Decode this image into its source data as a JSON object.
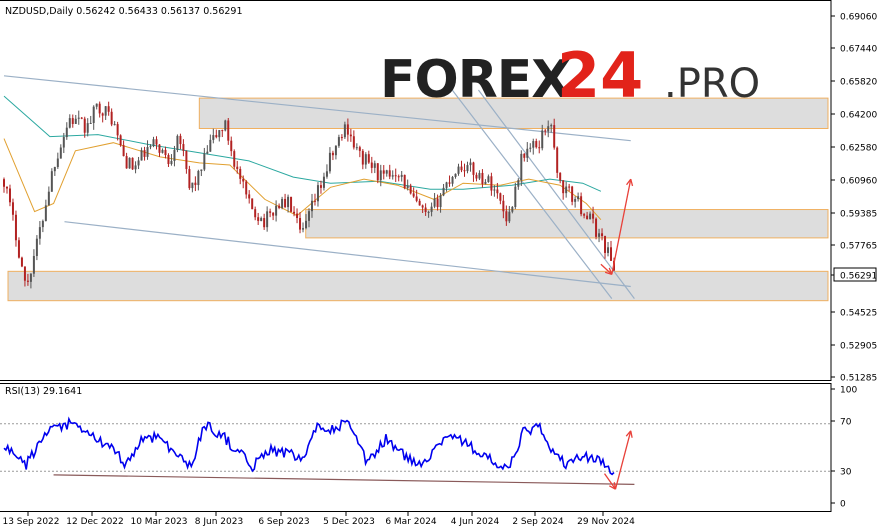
{
  "header": {
    "instrument_text": "NZDUSD,Daily  0.56242 0.56433 0.56137 0.56291"
  },
  "watermark": {
    "brand": "FOREX",
    "number": "24",
    "suffix": ".PRO",
    "colors": {
      "brand": "#222222",
      "number": "#e2231a",
      "suffix": "#333333"
    }
  },
  "chart_data": [
    {
      "type": "candlestick",
      "title": "NZDUSD,Daily",
      "ohlc_text": "0.56242 0.56433 0.56137 0.56291",
      "last_price": "0.56291",
      "ylim": [
        0.5128,
        0.6915
      ],
      "y_ticks": [
        "0.69060",
        "0.67440",
        "0.65820",
        "0.64200",
        "0.62580",
        "0.60960",
        "0.59385",
        "0.57765",
        "0.56291",
        "0.54525",
        "0.52905",
        "0.51285"
      ],
      "x_ticks": [
        "13 Sep 2022",
        "12 Dec 2022",
        "10 Mar 2023",
        "8 Jun 2023",
        "6 Sep 2023",
        "5 Dec 2023",
        "6 Mar 2024",
        "4 Jun 2024",
        "2 Sep 2024",
        "29 Nov 2024"
      ],
      "price_path": [
        [
          "2022-09-13",
          0.608
        ],
        [
          "2022-10-01",
          0.578
        ],
        [
          "2022-10-13",
          0.554
        ],
        [
          "2022-11-01",
          0.582
        ],
        [
          "2022-11-20",
          0.615
        ],
        [
          "2022-12-12",
          0.638
        ],
        [
          "2023-01-05",
          0.633
        ],
        [
          "2023-01-20",
          0.645
        ],
        [
          "2023-02-08",
          0.638
        ],
        [
          "2023-02-25",
          0.618
        ],
        [
          "2023-03-10",
          0.613
        ],
        [
          "2023-03-25",
          0.621
        ],
        [
          "2023-04-10",
          0.626
        ],
        [
          "2023-04-28",
          0.616
        ],
        [
          "2023-05-10",
          0.633
        ],
        [
          "2023-05-25",
          0.603
        ],
        [
          "2023-06-08",
          0.61
        ],
        [
          "2023-06-22",
          0.625
        ],
        [
          "2023-07-13",
          0.635
        ],
        [
          "2023-07-28",
          0.614
        ],
        [
          "2023-08-15",
          0.595
        ],
        [
          "2023-09-06",
          0.587
        ],
        [
          "2023-09-25",
          0.596
        ],
        [
          "2023-10-10",
          0.596
        ],
        [
          "2023-10-26",
          0.579
        ],
        [
          "2023-11-15",
          0.599
        ],
        [
          "2023-12-05",
          0.618
        ],
        [
          "2023-12-27",
          0.635
        ],
        [
          "2024-01-12",
          0.62
        ],
        [
          "2024-01-30",
          0.615
        ],
        [
          "2024-02-15",
          0.608
        ],
        [
          "2024-03-06",
          0.613
        ],
        [
          "2024-03-25",
          0.599
        ],
        [
          "2024-04-16",
          0.588
        ],
        [
          "2024-05-06",
          0.602
        ],
        [
          "2024-05-25",
          0.613
        ],
        [
          "2024-06-04",
          0.615
        ],
        [
          "2024-06-25",
          0.61
        ],
        [
          "2024-07-15",
          0.605
        ],
        [
          "2024-08-05",
          0.588
        ],
        [
          "2024-08-25",
          0.621
        ],
        [
          "2024-09-15",
          0.625
        ],
        [
          "2024-09-30",
          0.638
        ],
        [
          "2024-10-15",
          0.605
        ],
        [
          "2024-11-05",
          0.598
        ],
        [
          "2024-11-25",
          0.588
        ],
        [
          "2024-12-10",
          0.579
        ],
        [
          "2024-12-20",
          0.572
        ],
        [
          "2024-12-28",
          0.5629
        ]
      ],
      "ma_fast": [
        [
          "2022-09-13",
          0.628
        ],
        [
          "2022-10-25",
          0.592
        ],
        [
          "2022-11-20",
          0.596
        ],
        [
          "2022-12-20",
          0.622
        ],
        [
          "2023-02-10",
          0.626
        ],
        [
          "2023-04-15",
          0.619
        ],
        [
          "2023-06-08",
          0.616
        ],
        [
          "2023-07-20",
          0.615
        ],
        [
          "2023-09-06",
          0.598
        ],
        [
          "2023-10-20",
          0.59
        ],
        [
          "2023-12-05",
          0.604
        ],
        [
          "2024-01-20",
          0.608
        ],
        [
          "2024-03-06",
          0.605
        ],
        [
          "2024-04-25",
          0.598
        ],
        [
          "2024-06-04",
          0.606
        ],
        [
          "2024-07-25",
          0.605
        ],
        [
          "2024-09-02",
          0.608
        ],
        [
          "2024-10-15",
          0.605
        ],
        [
          "2024-11-20",
          0.596
        ],
        [
          "2024-12-10",
          0.588
        ]
      ],
      "ma_slow": [
        [
          "2022-09-13",
          0.649
        ],
        [
          "2022-11-15",
          0.629
        ],
        [
          "2023-01-20",
          0.63
        ],
        [
          "2023-04-01",
          0.625
        ],
        [
          "2023-06-08",
          0.621
        ],
        [
          "2023-08-15",
          0.617
        ],
        [
          "2023-10-15",
          0.609
        ],
        [
          "2023-12-05",
          0.606
        ],
        [
          "2024-02-10",
          0.607
        ],
        [
          "2024-04-20",
          0.603
        ],
        [
          "2024-06-04",
          0.603
        ],
        [
          "2024-08-10",
          0.605
        ],
        [
          "2024-10-01",
          0.608
        ],
        [
          "2024-11-15",
          0.606
        ],
        [
          "2024-12-10",
          0.602
        ]
      ],
      "zones": [
        {
          "from": "2023-06-08",
          "to": "end",
          "low": 0.633,
          "high": 0.648
        },
        {
          "from": "2023-11-01",
          "to": "end",
          "low": 0.579,
          "high": 0.593
        },
        {
          "from": "start",
          "to": "end",
          "low": 0.548,
          "high": 0.5625
        }
      ],
      "trend_lines": [
        {
          "from": [
            "2022-09-13",
            0.659
          ],
          "to": [
            "2025-01-20",
            0.627
          ]
        },
        {
          "from": [
            "2022-12-05",
            0.587
          ],
          "to": [
            "2025-01-20",
            0.555
          ]
        },
        {
          "from": [
            "2024-05-20",
            0.652
          ],
          "to": [
            "2024-12-25",
            0.549
          ]
        },
        {
          "from": [
            "2024-06-25",
            0.652
          ],
          "to": [
            "2025-01-25",
            0.549
          ]
        }
      ],
      "forecast_arrows": [
        {
          "from": [
            "2024-12-10",
            0.566
          ],
          "to": [
            "2024-12-25",
            0.561
          ]
        },
        {
          "from": [
            "2024-12-25",
            0.561
          ],
          "to": [
            "2025-01-20",
            0.608
          ]
        }
      ],
      "colors": {
        "price": "#b22222",
        "ma_fast": "#e1a030",
        "ma_slow": "#2ba8a0",
        "zone": "#dddddd",
        "zone_border": "#f0b060",
        "trend": "#9bb0c6",
        "arrow": "#e8413a"
      }
    },
    {
      "type": "line",
      "title": "RSI(13) 29.1641",
      "ylim": [
        0,
        100
      ],
      "y_ticks": [
        "100",
        "70",
        "30",
        "0"
      ],
      "levels": [
        70,
        30
      ],
      "rsi": [
        [
          "2022-09-13",
          50
        ],
        [
          "2022-10-13",
          35
        ],
        [
          "2022-11-10",
          62
        ],
        [
          "2022-12-12",
          70
        ],
        [
          "2023-01-10",
          60
        ],
        [
          "2023-02-05",
          50
        ],
        [
          "2023-02-28",
          36
        ],
        [
          "2023-03-20",
          56
        ],
        [
          "2023-04-15",
          60
        ],
        [
          "2023-05-10",
          42
        ],
        [
          "2023-05-28",
          34
        ],
        [
          "2023-06-15",
          70
        ],
        [
          "2023-07-13",
          58
        ],
        [
          "2023-08-20",
          34
        ],
        [
          "2023-09-10",
          48
        ],
        [
          "2023-10-10",
          45
        ],
        [
          "2023-10-26",
          38
        ],
        [
          "2023-11-20",
          70
        ],
        [
          "2023-12-10",
          65
        ],
        [
          "2023-12-27",
          72
        ],
        [
          "2024-01-25",
          36
        ],
        [
          "2024-02-20",
          58
        ],
        [
          "2024-03-06",
          48
        ],
        [
          "2024-04-01",
          35
        ],
        [
          "2024-04-16",
          42
        ],
        [
          "2024-05-15",
          62
        ],
        [
          "2024-06-04",
          55
        ],
        [
          "2024-07-05",
          42
        ],
        [
          "2024-08-05",
          30
        ],
        [
          "2024-08-25",
          62
        ],
        [
          "2024-09-15",
          68
        ],
        [
          "2024-10-10",
          42
        ],
        [
          "2024-10-25",
          35
        ],
        [
          "2024-11-10",
          42
        ],
        [
          "2024-11-25",
          42
        ],
        [
          "2024-12-15",
          36
        ],
        [
          "2024-12-28",
          29
        ]
      ],
      "support_line": {
        "from": [
          "2022-11-20",
          27
        ],
        "to": [
          "2025-01-25",
          19
        ]
      },
      "forecast_arrows": [
        {
          "from": [
            "2024-12-15",
            28
          ],
          "to": [
            "2024-12-30",
            15
          ]
        },
        {
          "from": [
            "2024-12-30",
            15
          ],
          "to": [
            "2025-01-20",
            64
          ]
        }
      ],
      "colors": {
        "rsi": "#0000ee",
        "support": "#8a5a5a",
        "arrow": "#e8413a"
      }
    }
  ]
}
